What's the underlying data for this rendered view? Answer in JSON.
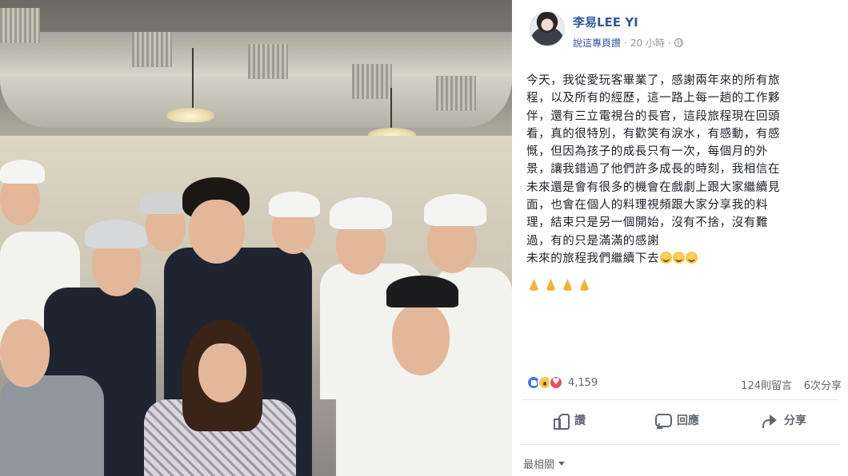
{
  "post": {
    "author": "李易LEE YI",
    "source": "說這專頁讚",
    "time": "20 小時",
    "body_lines": [
      "今天，我從愛玩客畢業了，感謝兩年來的所有旅",
      "程，以及所有的經歷，這一路上每一趟的工作夥",
      "伴，還有三立電視台的長官，這段旅程現在回頭",
      "看，真的很特別，有歡笑有淚水，有感動，有感",
      "慨，但因為孩子的成長只有一次，每個月的外",
      "景，讓我錯過了他們許多成長的時刻，我相信在",
      "未來還是會有很多的機會在戲劇上跟大家繼續見",
      "面，也會在個人的料理視頻跟大家分享我的料",
      "理，結束只是另一個開始，沒有不捨，沒有難",
      "過，有的只是滿滿的感謝",
      "未來的旅程我們繼續下去"
    ],
    "closing_emoji": [
      "grinning-face",
      "grinning-face",
      "grinning-face"
    ],
    "prayer_emoji": [
      "folded-hands",
      "folded-hands",
      "folded-hands",
      "folded-hands"
    ]
  },
  "stats": {
    "reactions": [
      "like",
      "wow",
      "love"
    ],
    "reaction_count": "4,159",
    "comments": "124則留言",
    "shares": "6次分享"
  },
  "actions": {
    "like": "讚",
    "comment": "回應",
    "share": "分享"
  },
  "sort": {
    "label": "最相關"
  },
  "colors": {
    "link": "#365899",
    "meta": "#90949c",
    "like_blue": "#4a76e8",
    "love_red": "#f04a5a",
    "wow_yellow": "#f7c84b"
  }
}
